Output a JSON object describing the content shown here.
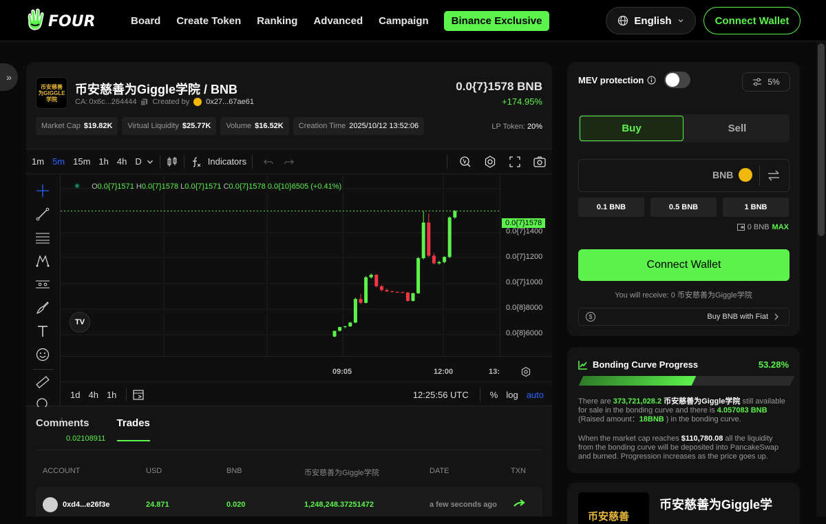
{
  "nav": {
    "logo_text": "FOUR",
    "links": [
      "Board",
      "Create Token",
      "Ranking",
      "Advanced",
      "Campaign"
    ],
    "exclusive_label": "Binance Exclusive",
    "language": "English",
    "connect_label": "Connect Wallet"
  },
  "token": {
    "img_line1": "币安慈善",
    "img_line2": "为GIGGLE",
    "img_line3": "学院",
    "pair": "币安慈善为Giggle学院 / BNB",
    "ca_label": "CA:",
    "ca_value": "0x6c...264444",
    "created_by_label": "Created by",
    "creator": "0x27...67ae61",
    "price": "0.0{7}1578 BNB",
    "change": "+174.95%",
    "stats": [
      {
        "label": "Market Cap",
        "value": "$19.82K"
      },
      {
        "label": "Virtual Liquidity",
        "value": "$25.77K"
      },
      {
        "label": "Volume",
        "value": "$16.52K"
      },
      {
        "label": "Creation Time",
        "value": "2025/10/12 13:52:06"
      }
    ],
    "lp_label": "LP Token:",
    "lp_value": "20%"
  },
  "chart_toolbar": {
    "timeframes": [
      "1m",
      "5m",
      "15m",
      "1h",
      "4h",
      "D"
    ],
    "active_timeframe": "5m",
    "indicators_label": "Indicators"
  },
  "chart_data": {
    "type": "candlestick",
    "ohlc": {
      "o_label": "O",
      "o": "0.0{7}1571",
      "h_label": "H",
      "h": "0.0{7}1578",
      "l_label": "L",
      "l": "0.0{7}1571",
      "c_label": "C",
      "c": "0.0{7}1578",
      "change": "0.0{10}6505 (+0.41%)"
    },
    "y_ticks": [
      "0.0{7}1400",
      "0.0{7}1200",
      "0.0{7}1000",
      "0.0{8}8000",
      "0.0{8}6000"
    ],
    "current_price_tag": "0.0{7}1578",
    "x_ticks": [
      "09:05",
      "12:00",
      "13:"
    ],
    "volume_label": "0.02108911",
    "y_unit_1e8": [
      6000,
      8000,
      10000,
      12000,
      14000
    ],
    "candles": [
      {
        "o": 5850,
        "h": 6300,
        "l": 5800,
        "c": 6300
      },
      {
        "o": 6300,
        "h": 6600,
        "l": 6250,
        "c": 6600
      },
      {
        "o": 6600,
        "h": 6700,
        "l": 6500,
        "c": 6650
      },
      {
        "o": 6650,
        "h": 7000,
        "l": 6600,
        "c": 6950
      },
      {
        "o": 6950,
        "h": 8900,
        "l": 6900,
        "c": 8800
      },
      {
        "o": 8800,
        "h": 9200,
        "l": 8400,
        "c": 8500
      },
      {
        "o": 8500,
        "h": 10600,
        "l": 8450,
        "c": 10500
      },
      {
        "o": 10500,
        "h": 10800,
        "l": 10400,
        "c": 10700
      },
      {
        "o": 10700,
        "h": 10750,
        "l": 9700,
        "c": 9800
      },
      {
        "o": 9800,
        "h": 9900,
        "l": 9400,
        "c": 9500
      },
      {
        "o": 9500,
        "h": 9600,
        "l": 9350,
        "c": 9400
      },
      {
        "o": 9400,
        "h": 9450,
        "l": 9300,
        "c": 9350
      },
      {
        "o": 9350,
        "h": 9400,
        "l": 9300,
        "c": 9330
      },
      {
        "o": 9330,
        "h": 9380,
        "l": 9250,
        "c": 9300
      },
      {
        "o": 9300,
        "h": 9350,
        "l": 8600,
        "c": 8650
      },
      {
        "o": 8650,
        "h": 9300,
        "l": 8600,
        "c": 9250
      },
      {
        "o": 9250,
        "h": 12100,
        "l": 9200,
        "c": 12000
      },
      {
        "o": 12000,
        "h": 15700,
        "l": 11900,
        "c": 14800
      },
      {
        "o": 14800,
        "h": 15500,
        "l": 12100,
        "c": 12200
      },
      {
        "o": 12200,
        "h": 12400,
        "l": 11500,
        "c": 11600
      },
      {
        "o": 11600,
        "h": 11800,
        "l": 11500,
        "c": 11700
      },
      {
        "o": 11700,
        "h": 12150,
        "l": 11600,
        "c": 12100
      },
      {
        "o": 12100,
        "h": 15300,
        "l": 12000,
        "c": 15200
      },
      {
        "o": 15200,
        "h": 15780,
        "l": 15100,
        "c": 15710
      }
    ]
  },
  "chart_bottom": {
    "ranges": [
      "1d",
      "4h",
      "1h"
    ],
    "time": "12:25:56 UTC",
    "pct": "%",
    "log": "log",
    "auto": "auto"
  },
  "tabs": {
    "comments": "Comments",
    "trades": "Trades"
  },
  "trades": {
    "headers": [
      "ACCOUNT",
      "USD",
      "BNB",
      "币安慈善为Giggle学院",
      "DATE",
      "TXN"
    ],
    "rows": [
      {
        "account": "0xd4...e26f3e",
        "usd": "24.871",
        "bnb": "0.020",
        "amount": "1,248,248.37251472",
        "date": "a few seconds ago"
      }
    ]
  },
  "trade_panel": {
    "mev_label": "MEV protection",
    "slippage": "5%",
    "buy_label": "Buy",
    "sell_label": "Sell",
    "currency": "BNB",
    "quick_amounts": [
      "0.1 BNB",
      "0.5 BNB",
      "1 BNB"
    ],
    "balance": "0 BNB",
    "max_label": "MAX",
    "connect_label": "Connect Wallet",
    "receive_text": "You will receive: 0 币安慈善为Giggle学院",
    "fiat_label": "Buy BNB with Fiat"
  },
  "bonding": {
    "title": "Bonding Curve Progress",
    "percent": "53.28%",
    "progress_fraction": 0.5328,
    "p1_a": "There are ",
    "p1_amount": "373,721,028.2",
    "p1_token": " 币安慈善为Giggle学院",
    "p1_b": " still available for sale in the bonding curve and there is ",
    "p1_bnb": "4.057083 BNB",
    "p1_c": " (Raised amount：",
    "p1_raised": "18BNB",
    "p1_d": " ) in the bonding curve.",
    "p2_a": "When the market cap reaches ",
    "p2_cap": "$110,780.08",
    "p2_b": " all the liquidity from the bonding curve will be deposited into PancakeSwap and burned. Progression increases as the price goes up."
  },
  "token_card": {
    "img_text": "币安慈善",
    "name": "币安慈善为Giggle学"
  },
  "colors": {
    "accent": "#5cf34c",
    "up": "#5cf34c",
    "down": "#f23645",
    "bg": "#0a0a0a",
    "panel": "#141414"
  }
}
